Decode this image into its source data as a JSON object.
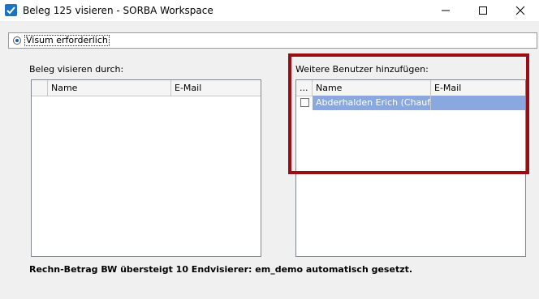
{
  "window": {
    "title": "Beleg 125 visieren - SORBA Workspace",
    "accent": "#1e73be"
  },
  "visum": {
    "label": "Visum erforderlich",
    "selected": true
  },
  "left_group": {
    "label": "Beleg visieren durch:",
    "columns": [
      "Name",
      "E-Mail"
    ],
    "rows": []
  },
  "right_group": {
    "label": "Weitere Benutzer hinzufügen:",
    "columns": [
      "...",
      "Name",
      "E-Mail"
    ],
    "rows": [
      {
        "checked": false,
        "name": "Abderhalden Erich (Chauf)",
        "email": ""
      }
    ],
    "selection_color": "#8aa8e0",
    "highlight_color": "#9b0d14"
  },
  "status": {
    "message": "Rechn-Betrag BW übersteigt 10 Endvisierer: em_demo automatisch gesetzt."
  },
  "icons": [
    "app-check-icon",
    "minimize-icon",
    "maximize-icon",
    "close-icon",
    "radio-icon",
    "checkbox-icon"
  ]
}
